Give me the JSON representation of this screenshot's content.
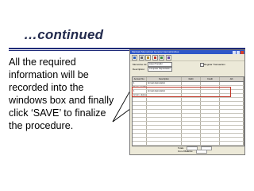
{
  "slide": {
    "title": "…continued",
    "body": "All the required information will be recorded into the windows box and finally click ‘SAVE’ to finalize the procedure."
  },
  "window": {
    "title": "Maintain Memorized General Journal Entries",
    "toolbar_icons": [
      "save-icon",
      "print-icon",
      "copy-icon",
      "delete-icon",
      "undo-icon",
      "help-icon"
    ],
    "form": {
      "memo_label": "Memorise As:",
      "memo_value": "Asset Transfer",
      "description_label": "Description:",
      "description_value": "Computer Depreciation",
      "recurring_label": "Regular Transaction"
    },
    "grid": {
      "columns": [
        "Account No.",
        "Description",
        "Debit",
        "Credit",
        "Job"
      ],
      "rows": [
        [
          "1",
          "Annual depreciation",
          "",
          "",
          ""
        ],
        [
          "Fixture machinery",
          "",
          "",
          "",
          ""
        ],
        [
          "1",
          "Annual depreciation",
          "",
          "",
          ""
        ],
        [
          "Accum. depreciation",
          "",
          "",
          "",
          ""
        ],
        [
          "",
          "",
          "",
          "",
          ""
        ],
        [
          "",
          "",
          "",
          "",
          ""
        ],
        [
          "",
          "",
          "",
          "",
          ""
        ],
        [
          "",
          "",
          "",
          "",
          ""
        ],
        [
          "",
          "",
          "",
          "",
          ""
        ],
        [
          "",
          "",
          "",
          "",
          ""
        ],
        [
          "",
          "",
          "",
          "",
          ""
        ],
        [
          "",
          "",
          "",
          "",
          ""
        ],
        [
          "",
          "",
          "",
          "",
          ""
        ],
        [
          "",
          "",
          "",
          "",
          ""
        ],
        [
          "",
          "",
          "",
          "",
          ""
        ],
        [
          "",
          "",
          "",
          "",
          ""
        ]
      ]
    },
    "totals": {
      "total_label": "Totals",
      "out_of_balance_label": "Out of Balance"
    }
  }
}
